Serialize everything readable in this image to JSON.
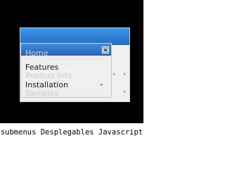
{
  "menu": {
    "top_item_faded": "Home",
    "items": [
      {
        "label": "Features",
        "state": "active",
        "has_submenu": false
      },
      {
        "label": "Product Info",
        "state": "disabled",
        "has_submenu": false
      },
      {
        "label": "Installation",
        "state": "active",
        "has_submenu": true
      },
      {
        "label": "Samples",
        "state": "disabled",
        "has_submenu": false
      }
    ],
    "close_icon": "close-icon",
    "submenu_arrow_icon": "triangle-right-icon"
  },
  "caption": "submenus Desplegables Javascript",
  "colors": {
    "background": "#000000",
    "title_bar": "#2a6fc9",
    "menu_bg": "#efefee",
    "text": "#1a1a1a",
    "disabled_text": "#c8c8c8"
  }
}
